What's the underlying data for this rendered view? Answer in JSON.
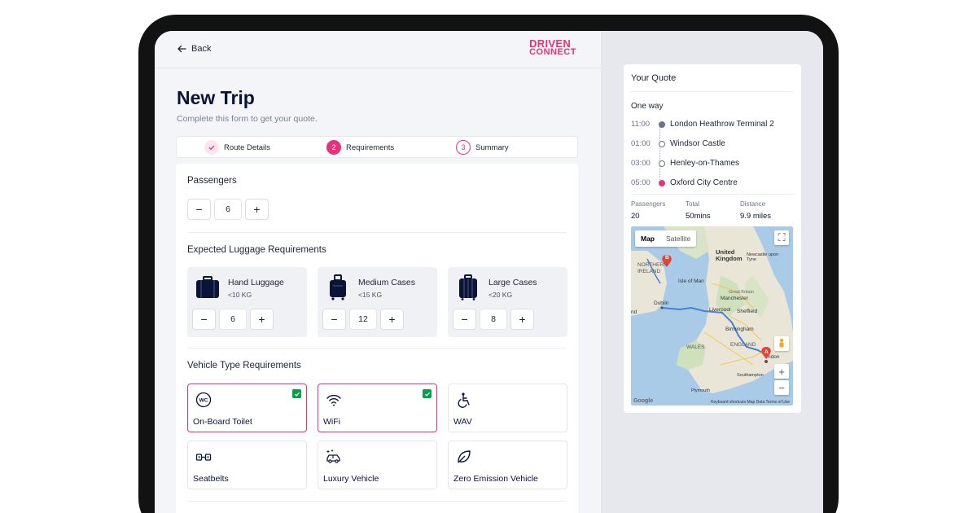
{
  "header": {
    "back_label": "Back",
    "logo_line1": "DRIVEN",
    "logo_line2": "CONNECT"
  },
  "page": {
    "title": "New Trip",
    "subtitle": "Complete this form to get your quote."
  },
  "steps": [
    {
      "num": "",
      "label": "Route Details",
      "state": "done"
    },
    {
      "num": "2",
      "label": "Requirements",
      "state": "active"
    },
    {
      "num": "3",
      "label": "Summary",
      "state": "todo"
    }
  ],
  "passengers": {
    "title": "Passengers",
    "value": "6",
    "minus": "−",
    "plus": "+"
  },
  "luggage": {
    "title": "Expected Luggage Requirements",
    "items": [
      {
        "name": "Hand Luggage",
        "weight": "<10 KG",
        "value": "6"
      },
      {
        "name": "Medium Cases",
        "weight": "<15 KG",
        "value": "12"
      },
      {
        "name": "Large Cases",
        "weight": "<20 KG",
        "value": "8"
      }
    ]
  },
  "vehicle": {
    "title": "Vehicle Type Requirements",
    "options": [
      {
        "label": "On-Board Toilet",
        "selected": true,
        "icon": "toilet-icon"
      },
      {
        "label": "WiFi",
        "selected": true,
        "icon": "wifi-icon"
      },
      {
        "label": "WAV",
        "selected": false,
        "icon": "wheelchair-icon"
      },
      {
        "label": "Seatbelts",
        "selected": false,
        "icon": "seatbelt-icon"
      },
      {
        "label": "Luxury Vehicle",
        "selected": false,
        "icon": "luxury-car-icon"
      },
      {
        "label": "Zero Emission Vehicle",
        "selected": false,
        "icon": "leaf-icon"
      }
    ]
  },
  "quote": {
    "title": "Your Quote",
    "trip_type": "One way",
    "stops": [
      {
        "time": "11:00",
        "place": "London Heathrow Terminal 2"
      },
      {
        "time": "01:00",
        "place": "Windsor Castle"
      },
      {
        "time": "03:00",
        "place": "Henley-on-Thames"
      },
      {
        "time": "05:00",
        "place": "Oxford City Centre"
      }
    ],
    "stats": [
      {
        "label": "Passengers",
        "value": "20"
      },
      {
        "label": "Total",
        "value": "50mins"
      },
      {
        "label": "Distance",
        "value": "9.9 miles"
      }
    ]
  },
  "map": {
    "tab_map": "Map",
    "tab_satellite": "Satellite",
    "labels": {
      "northern_ireland": "NORTHERN\nIRELAND",
      "isle_of_man": "Isle of Man",
      "united_kingdom": "United Kingdom",
      "newcastle": "Newcastle upon Tyne",
      "great_britain": "Great Britain",
      "manchester": "Manchester",
      "dublin": "Dublin",
      "liverpool": "Liverpool",
      "sheffield": "Sheffield",
      "birmingham": "Birmingham",
      "wales": "WALES",
      "england": "ENGLAND",
      "london": "ndon",
      "southampton": "Southampton",
      "plymouth": "Plymouth",
      "ireland_edge": "nd"
    },
    "marker_a": "A",
    "marker_b": "B",
    "zoom_in": "+",
    "zoom_out": "−",
    "footer": "Keyboard shortcuts   Map Data   Terms of Use",
    "google": "Google"
  },
  "colors": {
    "accent": "#e6327d",
    "check": "#0a9d4a",
    "navy": "#0b1437"
  }
}
